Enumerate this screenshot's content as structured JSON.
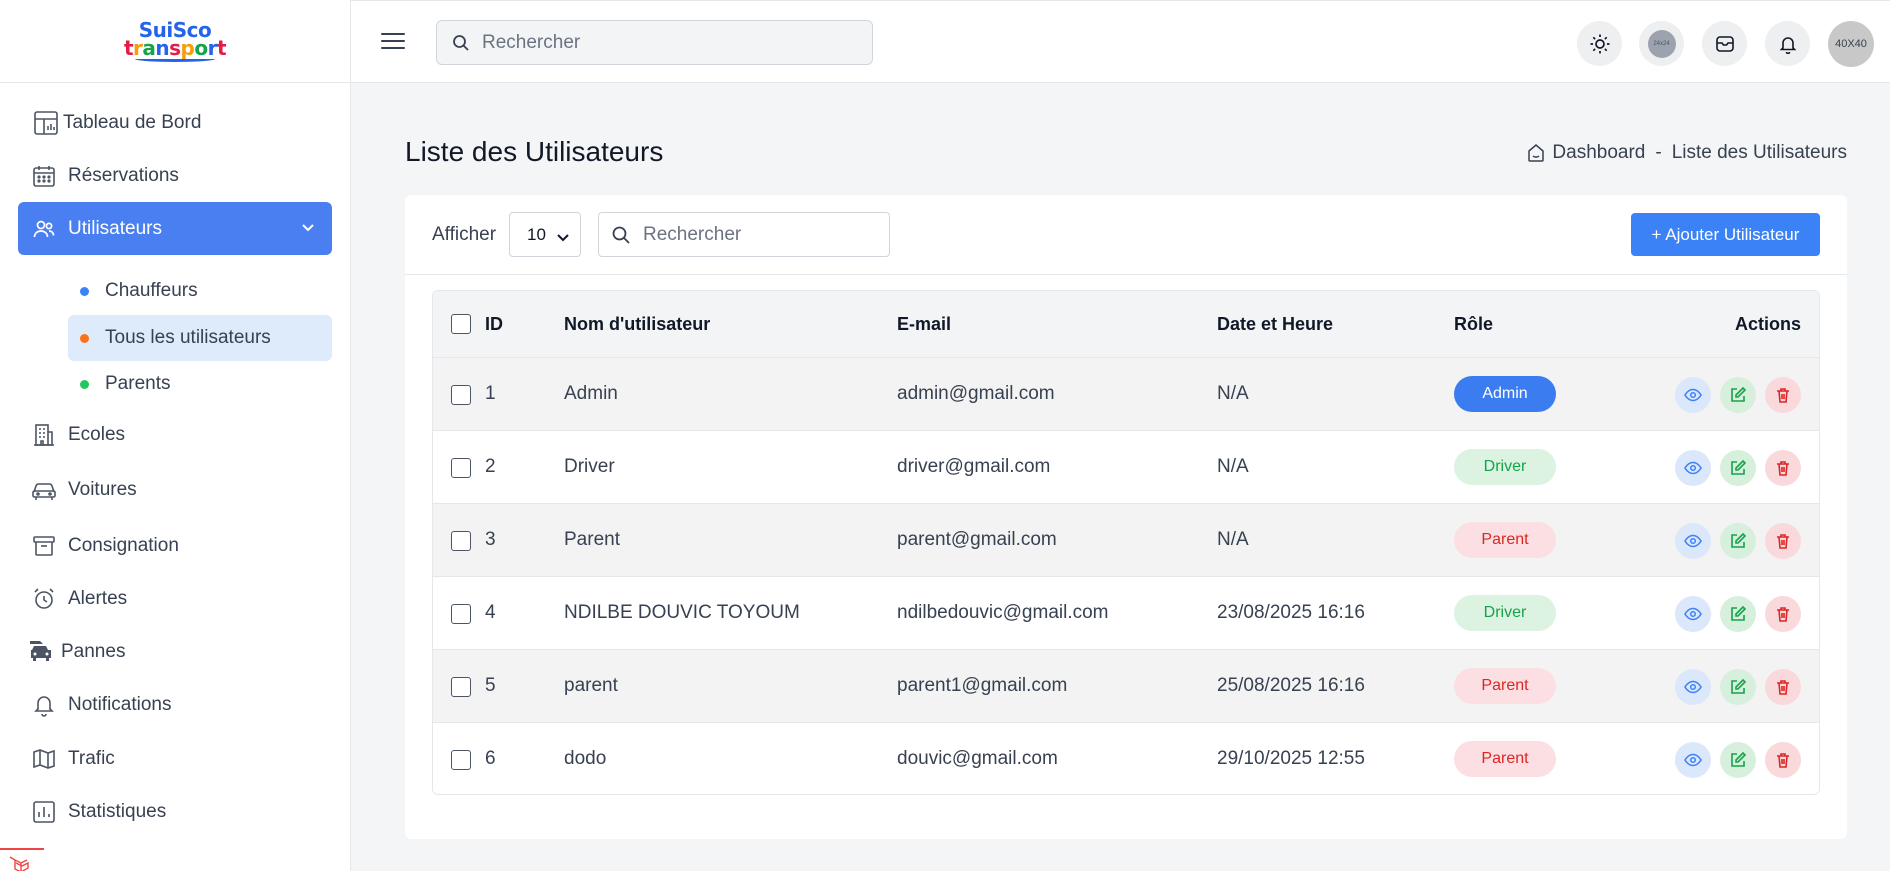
{
  "brand": {
    "line1": "SuiSco",
    "line2": "transport"
  },
  "sidebar": {
    "items": [
      {
        "label": "Tableau de Bord"
      },
      {
        "label": "Réservations"
      },
      {
        "label": "Utilisateurs"
      },
      {
        "label": "Ecoles"
      },
      {
        "label": "Voitures"
      },
      {
        "label": "Consignation"
      },
      {
        "label": "Alertes"
      },
      {
        "label": "Pannes"
      },
      {
        "label": "Notifications"
      },
      {
        "label": "Trafic"
      },
      {
        "label": "Statistiques"
      }
    ],
    "subitems": [
      {
        "label": "Chauffeurs",
        "color": "#3b82f6"
      },
      {
        "label": "Tous les utilisateurs",
        "color": "#f97316"
      },
      {
        "label": "Parents",
        "color": "#22c55e"
      }
    ]
  },
  "header": {
    "search_placeholder": "Rechercher",
    "avatar_small_text": "24x24",
    "avatar_text": "40X40"
  },
  "main": {
    "title": "Liste des Utilisateurs",
    "breadcrumb": {
      "home": "Dashboard",
      "sep": "-",
      "current": "Liste des Utilisateurs"
    },
    "show_label": "Afficher",
    "page_size": "10",
    "search_placeholder": "Rechercher",
    "add_button": "+ Ajouter Utilisateur"
  },
  "table": {
    "headers": {
      "id": "ID",
      "name": "Nom d'utilisateur",
      "email": "E-mail",
      "date": "Date et Heure",
      "role": "Rôle",
      "actions": "Actions"
    },
    "rows": [
      {
        "id": "1",
        "name": "Admin",
        "email": "admin@gmail.com",
        "date": "N/A",
        "role": "Admin"
      },
      {
        "id": "2",
        "name": "Driver",
        "email": "driver@gmail.com",
        "date": "N/A",
        "role": "Driver"
      },
      {
        "id": "3",
        "name": "Parent",
        "email": "parent@gmail.com",
        "date": "N/A",
        "role": "Parent"
      },
      {
        "id": "4",
        "name": "NDILBE DOUVIC TOYOUM",
        "email": "ndilbedouvic@gmail.com",
        "date": "23/08/2025 16:16",
        "role": "Driver"
      },
      {
        "id": "5",
        "name": "parent",
        "email": "parent1@gmail.com",
        "date": "25/08/2025 16:16",
        "role": "Parent"
      },
      {
        "id": "6",
        "name": "dodo",
        "email": "douvic@gmail.com",
        "date": "29/10/2025 12:55",
        "role": "Parent"
      }
    ]
  },
  "colors": {
    "accent": "#4a7ff1",
    "admin": "#3b7cf0",
    "driver": "#16a34a",
    "parent": "#dc2626"
  }
}
